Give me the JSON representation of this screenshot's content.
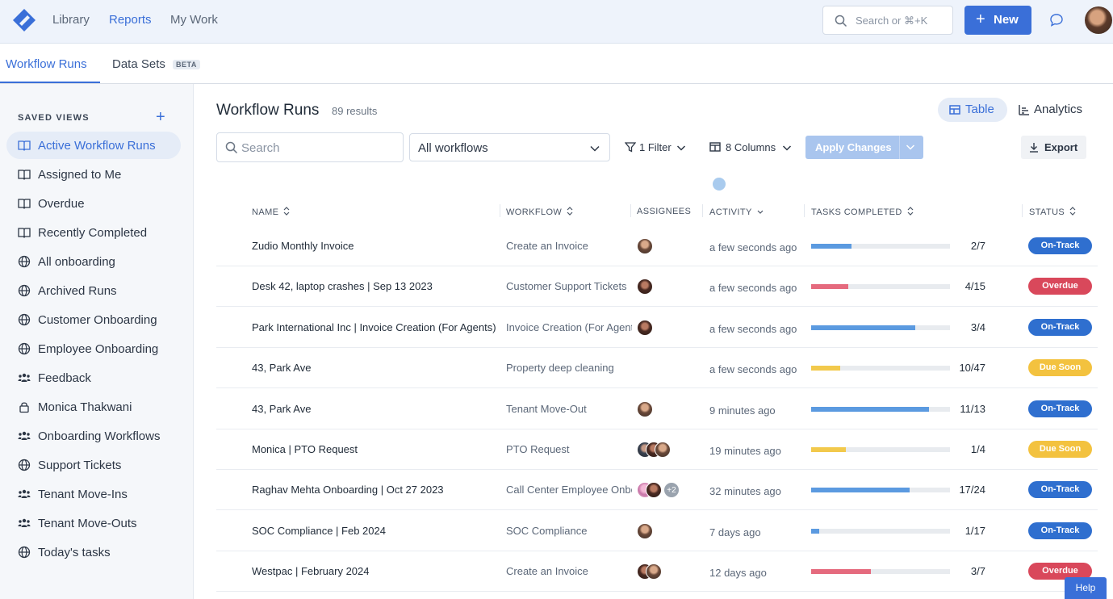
{
  "header": {
    "nav": [
      "Library",
      "Reports",
      "My Work"
    ],
    "active_nav": "Reports",
    "search_placeholder": "Search or ⌘+K",
    "new_label": "New",
    "accent": "#3a6fd8"
  },
  "tabs": {
    "workflow_runs": "Workflow Runs",
    "data_sets": "Data Sets",
    "beta": "BETA"
  },
  "sidebar": {
    "title": "SAVED VIEWS",
    "items": [
      {
        "label": "Active Workflow Runs",
        "icon": "book-icon",
        "active": true
      },
      {
        "label": "Assigned to Me",
        "icon": "book-icon"
      },
      {
        "label": "Overdue",
        "icon": "book-icon"
      },
      {
        "label": "Recently Completed",
        "icon": "book-icon"
      },
      {
        "label": "All onboarding",
        "icon": "globe-icon"
      },
      {
        "label": "Archived Runs",
        "icon": "globe-icon"
      },
      {
        "label": "Customer Onboarding",
        "icon": "globe-icon"
      },
      {
        "label": "Employee Onboarding",
        "icon": "globe-icon"
      },
      {
        "label": "Feedback",
        "icon": "team-icon"
      },
      {
        "label": "Monica Thakwani",
        "icon": "lock-icon"
      },
      {
        "label": "Onboarding Workflows",
        "icon": "team-icon"
      },
      {
        "label": "Support Tickets",
        "icon": "globe-icon"
      },
      {
        "label": "Tenant Move-Ins",
        "icon": "team-icon"
      },
      {
        "label": "Tenant Move-Outs",
        "icon": "team-icon"
      },
      {
        "label": "Today's tasks",
        "icon": "globe-icon"
      }
    ]
  },
  "main": {
    "title": "Workflow Runs",
    "results": "89 results",
    "view_table": "Table",
    "view_analytics": "Analytics",
    "search_placeholder": "Search",
    "workflow_select": "All workflows",
    "filter_label": "1 Filter",
    "columns_label": "8 Columns",
    "apply_label": "Apply Changes",
    "export_label": "Export"
  },
  "table": {
    "columns": [
      "NAME",
      "WORKFLOW",
      "ASSIGNEES",
      "ACTIVITY",
      "TASKS COMPLETED",
      "STATUS"
    ],
    "rows": [
      {
        "name": "Zudio Monthly Invoice",
        "workflow": "Create an Invoice",
        "assignees": [
          "p1"
        ],
        "activity": "a few seconds ago",
        "completed": 2,
        "total": 7,
        "count": "2/7",
        "status": "On-Track"
      },
      {
        "name": "Desk 42, laptop crashes | Sep 13 2023",
        "workflow": "Customer Support Tickets",
        "assignees": [
          "p2"
        ],
        "activity": "a few seconds ago",
        "completed": 4,
        "total": 15,
        "count": "4/15",
        "status": "Overdue"
      },
      {
        "name": "Park International Inc | Invoice Creation (For Agents)",
        "workflow": "Invoice Creation (For Agents)",
        "assignees": [
          "p2"
        ],
        "activity": "a few seconds ago",
        "completed": 3,
        "total": 4,
        "count": "3/4",
        "status": "On-Track"
      },
      {
        "name": "43, Park Ave",
        "workflow": "Property deep cleaning",
        "assignees": [],
        "activity": "a few seconds ago",
        "completed": 10,
        "total": 47,
        "count": "10/47",
        "status": "Due Soon"
      },
      {
        "name": "43, Park Ave",
        "workflow": "Tenant Move-Out",
        "assignees": [
          "p1"
        ],
        "activity": "9 minutes ago",
        "completed": 11,
        "total": 13,
        "count": "11/13",
        "status": "On-Track"
      },
      {
        "name": "Monica | PTO Request",
        "workflow": "PTO Request",
        "assignees": [
          "p3",
          "p2",
          "p1"
        ],
        "activity": "19 minutes ago",
        "completed": 1,
        "total": 4,
        "count": "1/4",
        "status": "Due Soon"
      },
      {
        "name": "Raghav Mehta Onboarding | Oct 27 2023",
        "workflow": "Call Center Employee Onboarding",
        "assignees": [
          "p4",
          "p2",
          "+2"
        ],
        "activity": "32 minutes ago",
        "completed": 17,
        "total": 24,
        "count": "17/24",
        "status": "On-Track"
      },
      {
        "name": "SOC Compliance | Feb 2024",
        "workflow": "SOC Compliance",
        "assignees": [
          "p1"
        ],
        "activity": "7 days ago",
        "completed": 1,
        "total": 17,
        "count": "1/17",
        "status": "On-Track"
      },
      {
        "name": "Westpac | February 2024",
        "workflow": "Create an Invoice",
        "assignees": [
          "p2",
          "p1"
        ],
        "activity": "12 days ago",
        "completed": 3,
        "total": 7,
        "count": "3/7",
        "status": "Overdue"
      }
    ]
  },
  "status_colors": {
    "On-Track": "#2f6fcf",
    "Overdue": "#d9485b",
    "Due Soon": "#f3c23f"
  },
  "bar_colors": {
    "On-Track": "#5b9ae0",
    "Overdue": "#e56a7e",
    "Due Soon": "#f2c94c"
  },
  "help": "Help"
}
